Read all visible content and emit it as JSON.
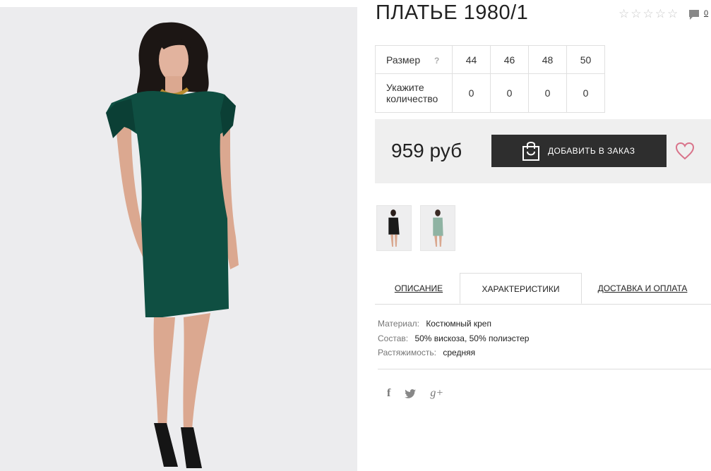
{
  "product": {
    "title": "ПЛАТЬЕ 1980/1",
    "rating_stars": 0,
    "rating_max": 5,
    "comments_count": "0"
  },
  "sizes": {
    "size_label": "Размер",
    "help_glyph": "?",
    "quantity_label_1": "Укажите",
    "quantity_label_2": "количество",
    "columns": [
      "44",
      "46",
      "48",
      "50"
    ],
    "quantities": [
      "0",
      "0",
      "0",
      "0"
    ]
  },
  "buy": {
    "price": "959 руб",
    "add_label": "ДОБАВИТЬ В ЗАКАЗ",
    "favorite_icon": "heart-icon"
  },
  "colors": {
    "dress_main": "#0f4f42",
    "thumb_black": "#1a1a1a",
    "thumb_mint": "#8fb3a3",
    "heart": "#d9738a",
    "button_bg": "#2e2e2e"
  },
  "tabs": [
    {
      "label": "ОПИСАНИЕ",
      "active": false
    },
    {
      "label": "ХАРАКТЕРИСТИКИ",
      "active": true
    },
    {
      "label": "ДОСТАВКА И ОПЛАТА",
      "active": false
    }
  ],
  "specs": [
    {
      "key": "Материал:",
      "value": "Костюмный креп"
    },
    {
      "key": "Состав:",
      "value": "50% вискоза, 50% полиэстер"
    },
    {
      "key": "Растяжимость:",
      "value": "средняя"
    }
  ],
  "social": {
    "facebook": "f",
    "twitter": "twitter-icon",
    "google_plus": "g+"
  }
}
